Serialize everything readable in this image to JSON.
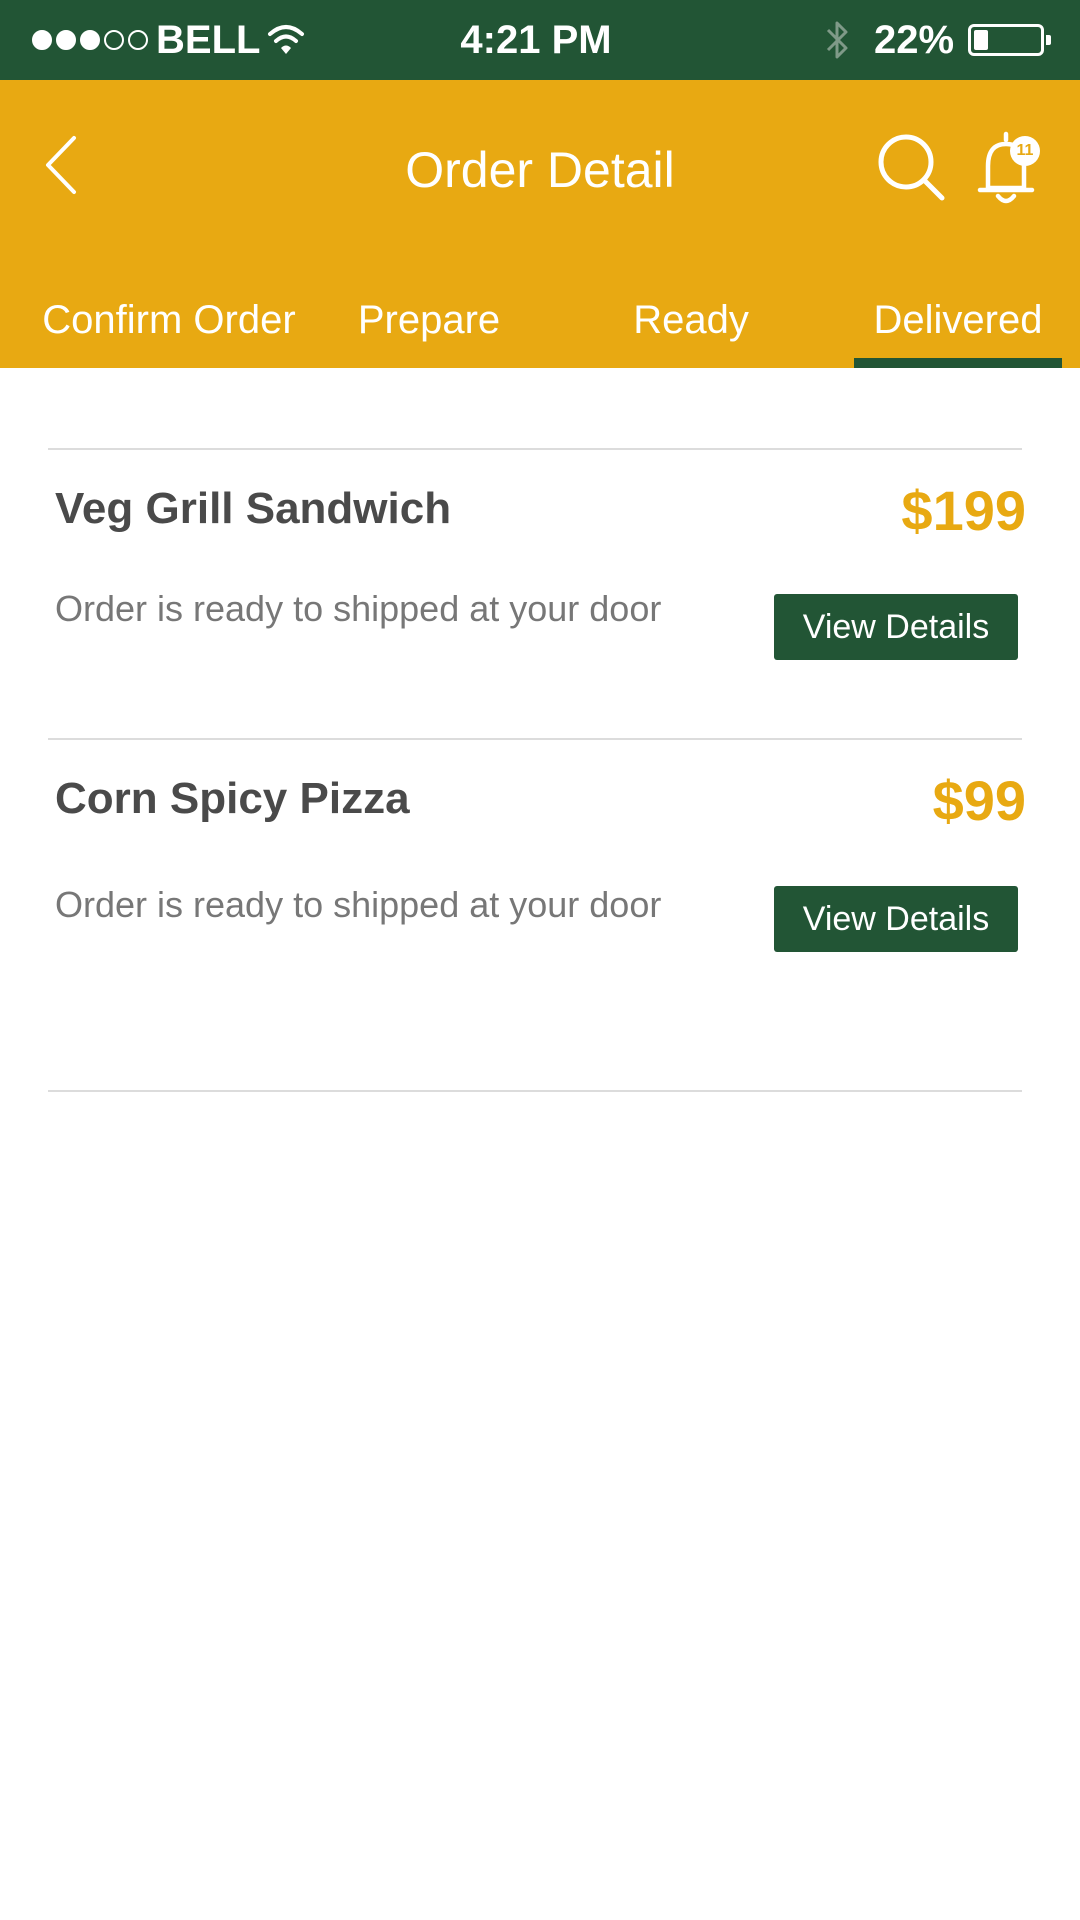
{
  "status_bar": {
    "signal_full": 3,
    "signal_total": 5,
    "carrier": "BELL",
    "time": "4:21 PM",
    "battery_percent": "22%",
    "battery_level": 0.22
  },
  "header": {
    "title": "Order Detail",
    "notification_count": "11"
  },
  "tabs": [
    {
      "label": "Confirm Order",
      "active": false
    },
    {
      "label": "Prepare",
      "active": false
    },
    {
      "label": "Ready",
      "active": false
    },
    {
      "label": "Delivered",
      "active": true
    }
  ],
  "orders": [
    {
      "name": "Veg Grill Sandwich",
      "price": "$199",
      "status": "Order is ready to shipped at your door",
      "button_label": "View Details"
    },
    {
      "name": "Corn Spicy Pizza",
      "price": "$99",
      "status": "Order is ready to shipped at your door",
      "button_label": "View Details"
    }
  ],
  "colors": {
    "primary_green": "#225535",
    "accent_yellow": "#e8a912",
    "text_dark": "#4a4a4a",
    "text_muted": "#777777"
  }
}
